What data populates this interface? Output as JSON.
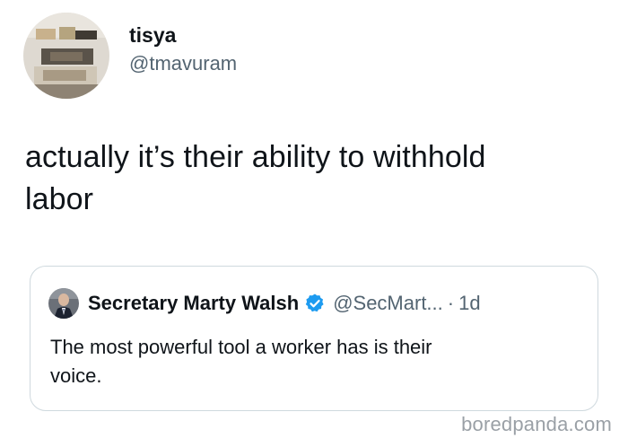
{
  "tweet": {
    "author": {
      "display_name": "tisya",
      "handle": "@tmavuram"
    },
    "text_line1": "actually it’s their ability to withhold",
    "text_line2": "labor",
    "quote": {
      "display_name": "Secretary Marty Walsh",
      "verified_icon": "verified-badge-icon",
      "handle": "@SecMart...",
      "separator": "·",
      "time": "1d",
      "text_line1": "The most powerful tool a worker has is their",
      "text_line2": "voice."
    }
  },
  "watermark": "boredpanda.com",
  "colors": {
    "text_primary": "#0f1419",
    "text_secondary": "#536471",
    "verified_blue": "#1d9bf0",
    "quote_border": "#cfd9de",
    "watermark": "#9aa0a6"
  }
}
